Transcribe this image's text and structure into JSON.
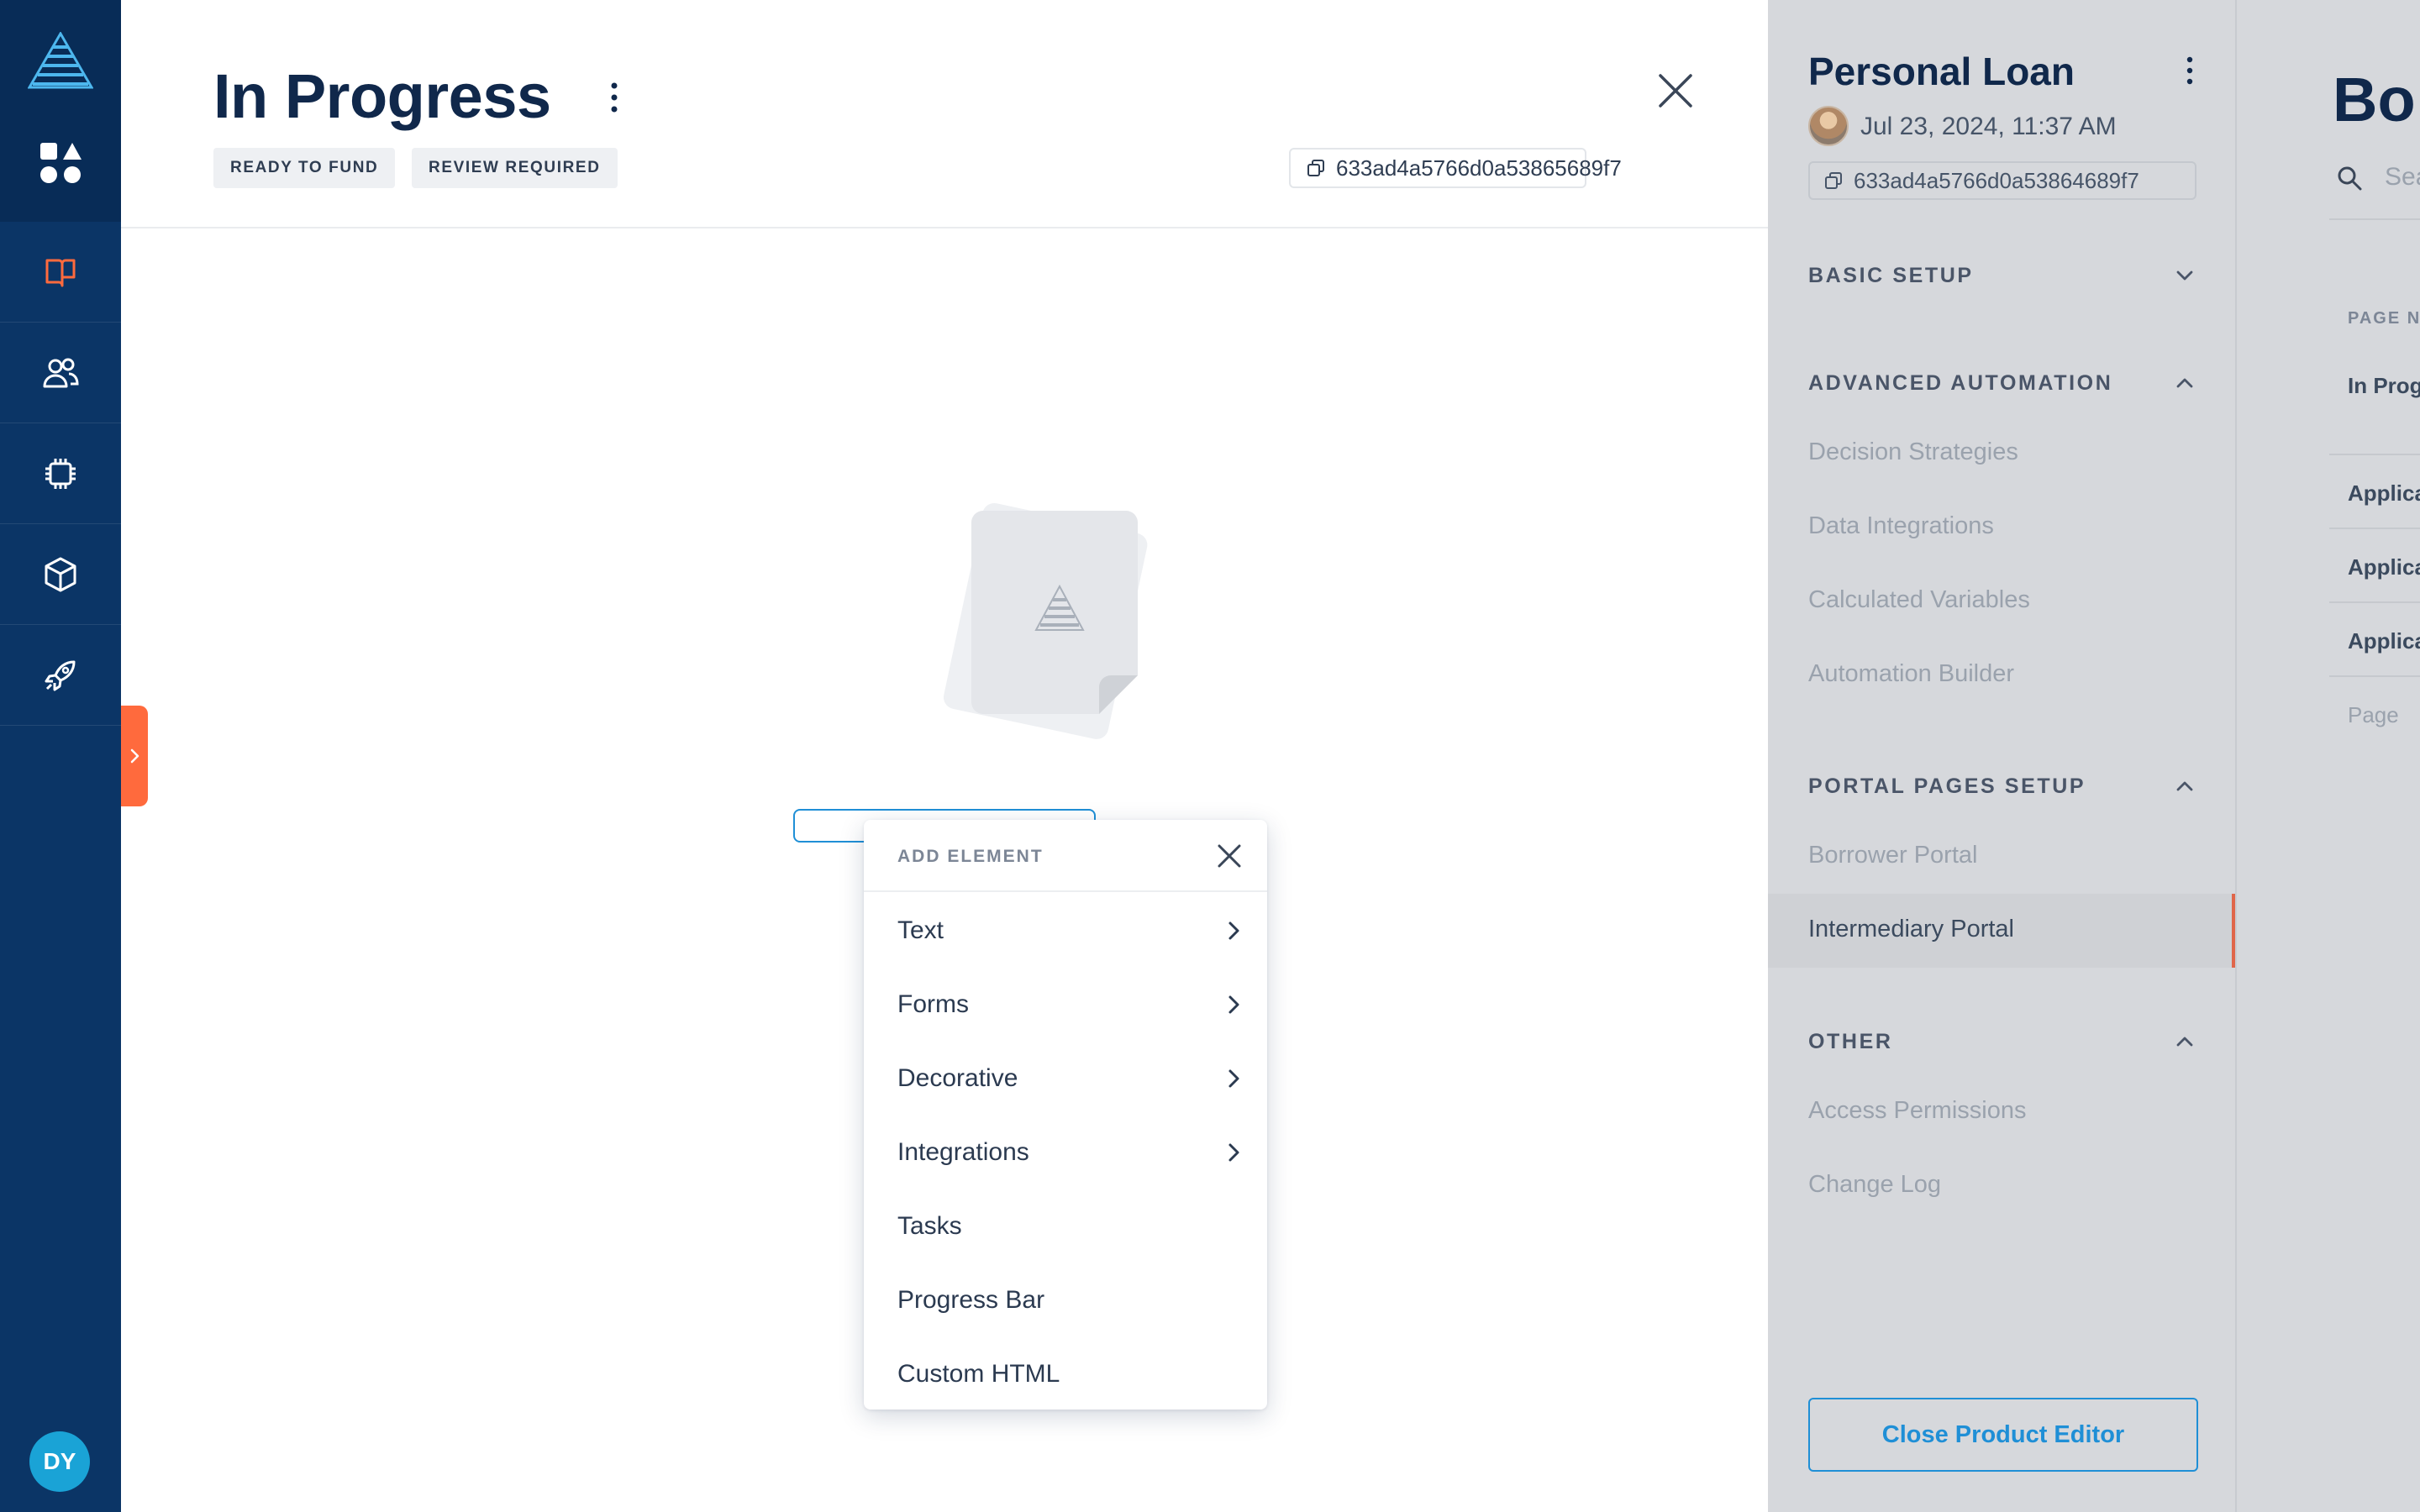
{
  "colors": {
    "nav_bg": "#0b3566",
    "accent_orange": "#ff6a3d",
    "accent_blue": "#1f8fd6",
    "title_navy": "#10284b",
    "sidebar_bg": "#d6d8dc"
  },
  "leftnav": {
    "logo_icon": "triangle-logo-icon",
    "items": [
      {
        "name": "apps-icon"
      },
      {
        "name": "book-icon",
        "active": true
      },
      {
        "name": "users-icon"
      },
      {
        "name": "chip-icon"
      },
      {
        "name": "cube-icon"
      },
      {
        "name": "rocket-icon"
      }
    ],
    "user_initials": "DY"
  },
  "main": {
    "title": "In Progress",
    "tags": [
      "READY TO FUND",
      "REVIEW REQUIRED"
    ],
    "id": "633ad4a5766d0a53865689f7"
  },
  "popup": {
    "title": "ADD ELEMENT",
    "items": [
      {
        "label": "Text",
        "submenu": true
      },
      {
        "label": "Forms",
        "submenu": true
      },
      {
        "label": "Decorative",
        "submenu": true
      },
      {
        "label": "Integrations",
        "submenu": true
      },
      {
        "label": "Tasks",
        "submenu": false
      },
      {
        "label": "Progress Bar",
        "submenu": false
      },
      {
        "label": "Custom HTML",
        "submenu": false
      }
    ]
  },
  "sidebar": {
    "title": "Personal Loan",
    "date": "Jul 23, 2024, 11:37 AM",
    "id": "633ad4a5766d0a53864689f7",
    "sections": [
      {
        "title": "BASIC SETUP",
        "expanded": false,
        "items": []
      },
      {
        "title": "ADVANCED AUTOMATION",
        "expanded": true,
        "items": [
          "Decision Strategies",
          "Data Integrations",
          "Calculated Variables",
          "Automation Builder"
        ]
      },
      {
        "title": "PORTAL PAGES SETUP",
        "expanded": true,
        "items": [
          "Borrower Portal",
          "Intermediary Portal"
        ],
        "active": "Intermediary Portal"
      },
      {
        "title": "OTHER",
        "expanded": true,
        "items": [
          "Access Permissions",
          "Change Log"
        ]
      }
    ],
    "close_button": "Close Product Editor"
  },
  "farright": {
    "title": "Bo",
    "search_placeholder": "Sea",
    "column_header": "PAGE NA",
    "rows": [
      "In Prog",
      "Applica",
      "Applica",
      "Applica"
    ],
    "footer": "Page"
  }
}
